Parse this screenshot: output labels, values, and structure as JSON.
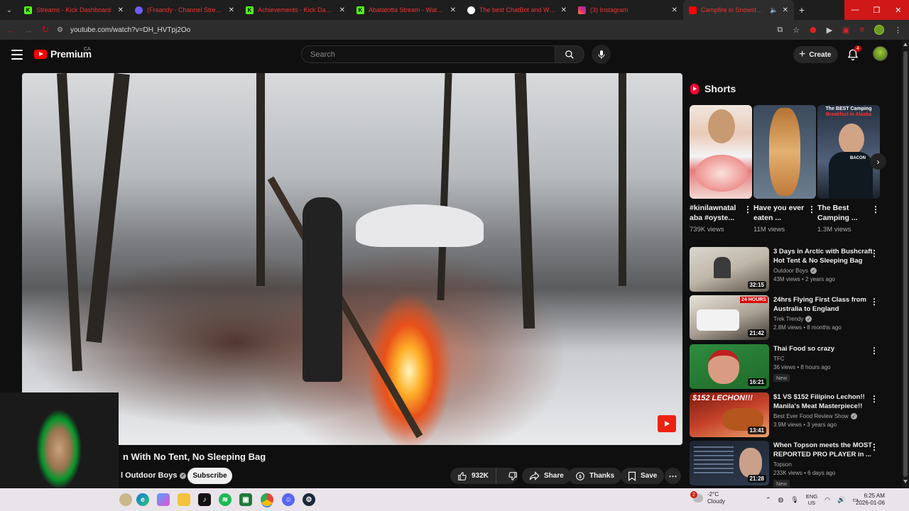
{
  "browser": {
    "tabs": [
      {
        "title": "Streams - Kick Dashboard",
        "icon": "kick-icon",
        "color": "#53fc18"
      },
      {
        "title": "(Fraandy - Channel Streams on",
        "icon": "channel-icon",
        "color": "#6e5df5"
      },
      {
        "title": "Achievements - Kick Dashboard",
        "icon": "kick-icon",
        "color": "#53fc18"
      },
      {
        "title": "Abatatotta Stream - Watch Live",
        "icon": "kick-icon",
        "color": "#53fc18"
      },
      {
        "title": "The best ChatBot and Widgets",
        "icon": "chatbot-icon",
        "color": "#ffffff"
      },
      {
        "title": "(3) Instagram",
        "icon": "instagram-icon",
        "color": "#e1306c"
      },
      {
        "title": "Campfire in Snowstorm",
        "icon": "youtube-icon",
        "color": "#ff0000"
      }
    ],
    "url": "youtube.com/watch?v=DH_HVTpj2Oo"
  },
  "header": {
    "logo": "Premium",
    "region": "CA",
    "search_placeholder": "Search",
    "create_label": "Create",
    "notification_count": "4"
  },
  "video": {
    "title": "n With No Tent, No Sleeping Bag",
    "channel": "l Outdoor Boys",
    "subscribe_label": "Subscribe",
    "likes": "932K",
    "share_label": "Share",
    "thanks_label": "Thanks",
    "save_label": "Save"
  },
  "shorts": {
    "heading": "Shorts",
    "items": [
      {
        "title": "#kinilawnatal aba #oyste...",
        "views": "739K views"
      },
      {
        "title": "Have you ever eaten ...",
        "views": "11M views"
      },
      {
        "title": "The Best Camping ...",
        "views": "1.3M views",
        "thumb_line1": "The BEST Camping",
        "thumb_line2": "Breakfast in Alaska",
        "thumb_tag": "BACON"
      }
    ]
  },
  "recommendations": [
    {
      "title": "3 Days in Arctic with Bushcraft Hot Tent & No Sleeping Bag",
      "channel": "Outdoor Boys",
      "verified": true,
      "meta": "43M views • 2 years ago",
      "duration": "32:15",
      "badge": ""
    },
    {
      "title": "24hrs Flying First Class from Australia to England",
      "channel": "Trek Trendy",
      "verified": true,
      "meta": "2.8M views • 8 months ago",
      "duration": "21:42",
      "badge": "",
      "banner": "24 HOURS"
    },
    {
      "title": "Thai Food so crazy",
      "channel": "TFC",
      "verified": false,
      "meta": "36 views • 8 hours ago",
      "duration": "16:21",
      "badge": "New"
    },
    {
      "title": "$1 VS $152 Filipino Lechon!! Manila's Meat Masterpiece!!",
      "channel": "Best Ever Food Review Show",
      "verified": true,
      "meta": "3.9M views • 3 years ago",
      "duration": "13:41",
      "badge": "",
      "big": "$152 LECHON!!!"
    },
    {
      "title": "When Topson meets the MOST REPORTED PRO PLAYER in ...",
      "channel": "Topson",
      "verified": false,
      "meta": "233K views • 6 days ago",
      "duration": "21:28",
      "badge": "New"
    }
  ],
  "taskbar": {
    "weather_badge": "2",
    "temperature": "-2°C",
    "condition": "Cloudy",
    "lang_line1": "ENG",
    "lang_line2": "US",
    "time": "6:25 AM",
    "date": "2026-01-06"
  },
  "colors": {
    "accent_red": "#ff0000",
    "background": "#0f0f0f",
    "kick_green": "#53fc18"
  }
}
